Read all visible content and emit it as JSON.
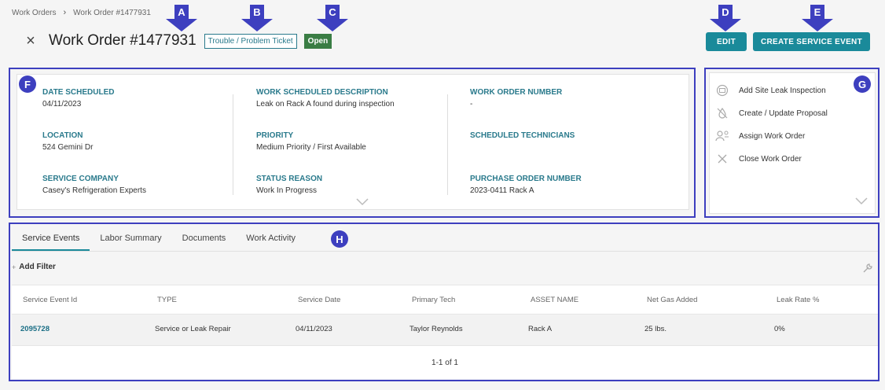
{
  "breadcrumb": {
    "root": "Work Orders",
    "separator": "›",
    "current": "Work Order #1477931"
  },
  "header": {
    "close_icon": "×",
    "title": "Work Order #1477931",
    "type_badge": "Trouble / Problem Ticket",
    "status_badge": "Open"
  },
  "toolbar": {
    "edit_label": "EDIT",
    "create_label": "CREATE SERVICE EVENT"
  },
  "markers": {
    "a": "A",
    "b": "B",
    "c": "C",
    "d": "D",
    "e": "E",
    "f": "F",
    "g": "G",
    "h": "H"
  },
  "details": {
    "date_scheduled_label": "DATE SCHEDULED",
    "date_scheduled": "04/11/2023",
    "location_label": "LOCATION",
    "location": "524 Gemini Dr",
    "service_company_label": "SERVICE COMPANY",
    "service_company": "Casey's Refrigeration Experts",
    "work_description_label": "WORK SCHEDULED DESCRIPTION",
    "work_description": "Leak on Rack A found during inspection",
    "priority_label": "PRIORITY",
    "priority": "Medium Priority / First Available",
    "status_reason_label": "STATUS REASON",
    "status_reason": "Work In Progress",
    "work_order_number_label": "WORK ORDER NUMBER",
    "work_order_number": "-",
    "technicians_label": "SCHEDULED TECHNICIANS",
    "po_number_label": "PURCHASE ORDER NUMBER",
    "po_number": "2023-0411 Rack A",
    "expand_icon": "chevron-down-icon"
  },
  "actions": [
    {
      "label": "Add Site Leak Inspection",
      "icon": "inspection-icon"
    },
    {
      "label": "Create / Update Proposal",
      "icon": "proposal-icon"
    },
    {
      "label": "Assign Work Order",
      "icon": "assign-user-icon"
    },
    {
      "label": "Close Work Order",
      "icon": "close-icon"
    }
  ],
  "tabs": [
    "Service Events",
    "Labor Summary",
    "Documents",
    "Work Activity"
  ],
  "filter": {
    "add_label": "Add Filter"
  },
  "table": {
    "columns": [
      "Service Event Id",
      "TYPE",
      "Service Date",
      "Primary Tech",
      "ASSET NAME",
      "Net Gas Added",
      "Leak Rate %"
    ],
    "rows": [
      [
        "2095728",
        "Service or Leak Repair",
        "04/11/2023",
        "Taylor Reynolds",
        "Rack A",
        "25 lbs.",
        "0%"
      ]
    ],
    "pagination": "1-1 of 1"
  },
  "colors": {
    "accent": "#1a8a9a",
    "label": "#2a7a8c",
    "status_open": "#3a7d44",
    "annotation": "#3d3fbf"
  }
}
